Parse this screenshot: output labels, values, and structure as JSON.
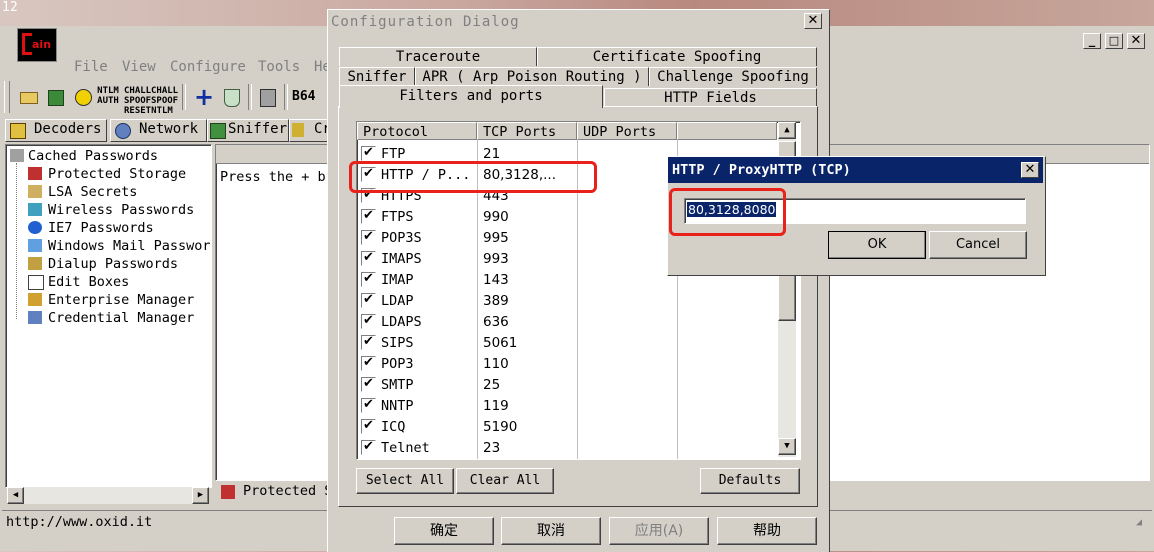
{
  "corner_text": "12",
  "app": {
    "logo_text": "ain",
    "menu": [
      "File",
      "View",
      "Configure",
      "Tools",
      "He"
    ],
    "toolbar_icons": [
      {
        "name": "open-icon",
        "label": ""
      },
      {
        "name": "network-card-icon",
        "label": ""
      },
      {
        "name": "radiation-icon",
        "label": ""
      },
      {
        "name": "ntlm-auth-icon",
        "label": "NTLM AUTH"
      },
      {
        "name": "chall-spoof-reset-icon",
        "label": "CHALL SPOOF RESET"
      },
      {
        "name": "chall-spoof-ntlm-icon",
        "label": "CHALL SPOOF NTLM"
      },
      {
        "name": "add-icon",
        "label": ""
      },
      {
        "name": "certificate-icon",
        "label": ""
      },
      {
        "name": "calculator-icon",
        "label": ""
      },
      {
        "name": "base64-icon",
        "label": "B64"
      }
    ],
    "tabs": [
      "Decoders",
      "Network",
      "Sniffer",
      "Cr"
    ],
    "tree": {
      "root": "Cached Passwords",
      "items": [
        "Protected Storage",
        "LSA Secrets",
        "Wireless Passwords",
        "IE7 Passwords",
        "Windows Mail Passwor",
        "Dialup Passwords",
        "Edit Boxes",
        "Enterprise Manager",
        "Credential Manager"
      ]
    },
    "content_hint": "Press the + b",
    "bottom_tab": "Protected S",
    "status": "http://www.oxid.it"
  },
  "config_dialog": {
    "title": "Configuration Dialog",
    "tabs_row1": [
      "Traceroute",
      "Certificate Spoofing"
    ],
    "tabs_row2": [
      "Sniffer",
      "APR ( Arp Poison Routing )",
      "Challenge Spoofing"
    ],
    "tabs_row3": [
      "Filters and ports",
      "HTTP Fields"
    ],
    "columns": [
      "Protocol",
      "TCP Ports",
      "UDP Ports"
    ],
    "rows": [
      {
        "protocol": "FTP",
        "tcp": "21"
      },
      {
        "protocol": "HTTP / P...",
        "tcp": "80,3128,..."
      },
      {
        "protocol": "HTTPS",
        "tcp": "443"
      },
      {
        "protocol": "FTPS",
        "tcp": "990"
      },
      {
        "protocol": "POP3S",
        "tcp": "995"
      },
      {
        "protocol": "IMAPS",
        "tcp": "993"
      },
      {
        "protocol": "IMAP",
        "tcp": "143"
      },
      {
        "protocol": "LDAP",
        "tcp": "389"
      },
      {
        "protocol": "LDAPS",
        "tcp": "636"
      },
      {
        "protocol": "SIPS",
        "tcp": "5061"
      },
      {
        "protocol": "POP3",
        "tcp": "110"
      },
      {
        "protocol": "SMTP",
        "tcp": "25"
      },
      {
        "protocol": "NNTP",
        "tcp": "119"
      },
      {
        "protocol": "ICQ",
        "tcp": "5190"
      },
      {
        "protocol": "Telnet",
        "tcp": "23"
      }
    ],
    "select_all": "Select All",
    "clear_all": "Clear All",
    "defaults": "Defaults",
    "ok": "确定",
    "cancel": "取消",
    "apply": "应用(A)",
    "help": "帮助"
  },
  "port_popup": {
    "title": "HTTP / ProxyHTTP (TCP)",
    "value": "80,3128,8080",
    "ok": "OK",
    "cancel": "Cancel"
  },
  "colors": {
    "titlebar_active": "#0a246a",
    "highlight_box": "#e8211b",
    "selection": "#0a246a"
  }
}
